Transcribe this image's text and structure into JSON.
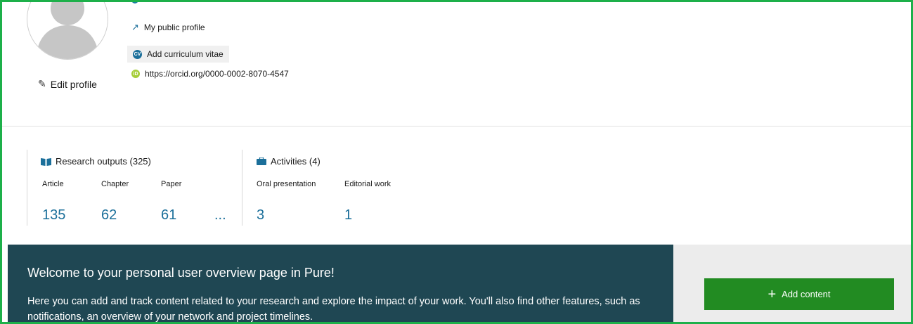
{
  "profile": {
    "edit_label": "Edit profile",
    "public_profile_label": "My public profile",
    "add_cv_label": "Add curriculum vitae",
    "cv_badge": "CV",
    "orcid_badge": "iD",
    "orcid_url": "https://orcid.org/0000-0002-8070-4547"
  },
  "stats": {
    "research_outputs": {
      "label": "Research outputs (325)",
      "items": [
        {
          "label": "Article",
          "count": "135"
        },
        {
          "label": "Chapter",
          "count": "62"
        },
        {
          "label": "Paper",
          "count": "61"
        }
      ],
      "more": "..."
    },
    "activities": {
      "label": "Activities (4)",
      "items": [
        {
          "label": "Oral presentation",
          "count": "3"
        },
        {
          "label": "Editorial work",
          "count": "1"
        }
      ]
    }
  },
  "welcome": {
    "title": "Welcome to your personal user overview page in Pure!",
    "body": "Here you can add and track content related to your research and explore the impact of your work. You'll also find other features, such as notifications, an overview of your network and project timelines."
  },
  "add_content": {
    "label": "Add content"
  },
  "colors": {
    "frame_border": "#1db04a",
    "link_blue": "#1b6f9a",
    "banner_bg": "#1f4753",
    "button_green": "#228b22",
    "orcid_green": "#a6ce39"
  }
}
